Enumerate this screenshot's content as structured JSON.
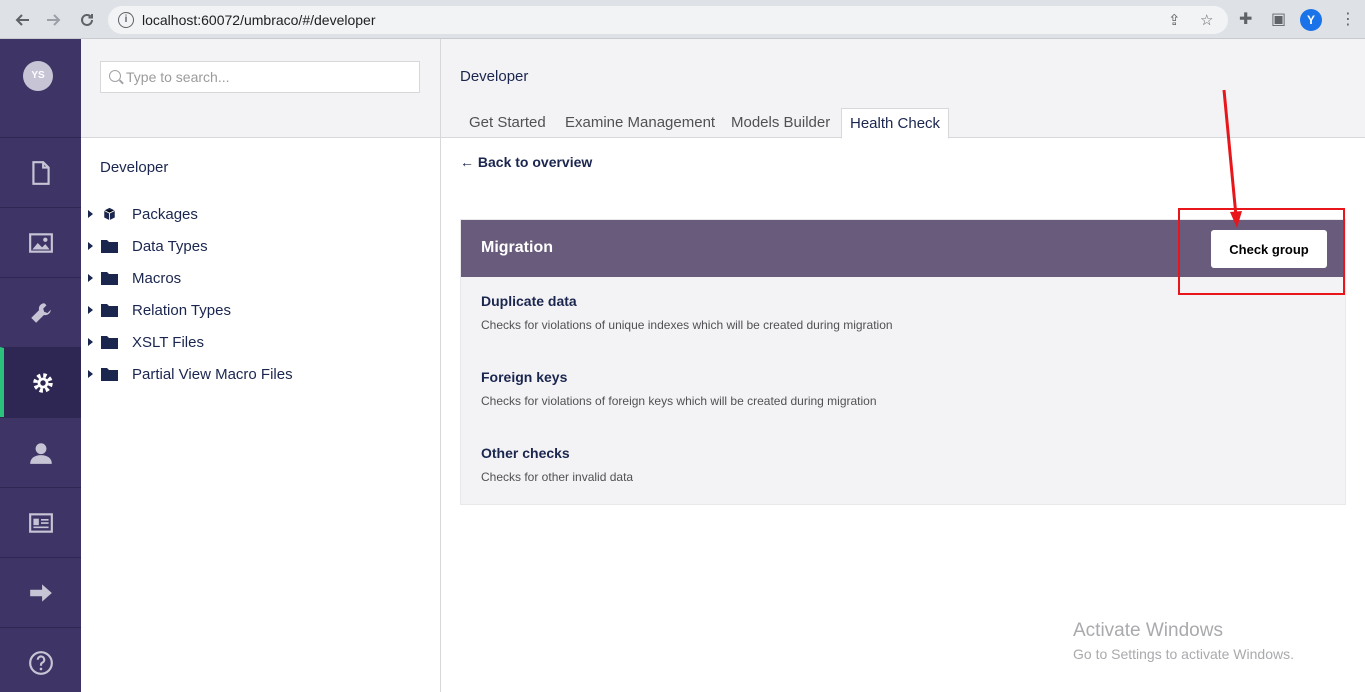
{
  "browser": {
    "url": "localhost:60072/umbraco/#/developer",
    "profile_initial": "Y",
    "icons": [
      "back-arrow-icon",
      "forward-arrow-icon",
      "reload-icon",
      "info-icon",
      "share-icon",
      "star-icon",
      "extensions-icon",
      "side-panel-icon",
      "kebab-menu-icon"
    ]
  },
  "sections": {
    "avatar": "YS",
    "items": [
      {
        "name": "content",
        "icon": "document-icon"
      },
      {
        "name": "media",
        "icon": "image-icon"
      },
      {
        "name": "settings",
        "icon": "wrench-icon"
      },
      {
        "name": "developer",
        "icon": "gear-icon",
        "active": true
      },
      {
        "name": "users",
        "icon": "user-icon"
      },
      {
        "name": "members",
        "icon": "id-card-icon"
      },
      {
        "name": "forms",
        "icon": "arrow-right-icon"
      },
      {
        "name": "help",
        "icon": "help-icon"
      }
    ],
    "accent_color": "#2bc37c",
    "background_color": "#3e3465"
  },
  "tree": {
    "search_placeholder": "Type to search...",
    "title": "Developer",
    "items": [
      {
        "label": "Packages",
        "icon": "package-icon"
      },
      {
        "label": "Data Types",
        "icon": "folder-icon"
      },
      {
        "label": "Macros",
        "icon": "folder-icon"
      },
      {
        "label": "Relation Types",
        "icon": "folder-icon"
      },
      {
        "label": "XSLT Files",
        "icon": "folder-icon"
      },
      {
        "label": "Partial View Macro Files",
        "icon": "folder-icon"
      }
    ]
  },
  "main": {
    "title": "Developer",
    "tabs": [
      {
        "label": "Get Started"
      },
      {
        "label": "Examine Management"
      },
      {
        "label": "Models Builder"
      },
      {
        "label": "Health Check",
        "active": true
      }
    ],
    "back_link": "← Back to overview",
    "group": {
      "title": "Migration",
      "button_label": "Check group",
      "header_color": "#685b7b",
      "checks": [
        {
          "name": "Duplicate data",
          "description": "Checks for violations of unique indexes which will be created during migration"
        },
        {
          "name": "Foreign keys",
          "description": "Checks for violations of foreign keys which will be created during migration"
        },
        {
          "name": "Other checks",
          "description": "Checks for other invalid data"
        }
      ]
    }
  },
  "annotation_color": "#e8161b",
  "watermark": {
    "line1": "Activate Windows",
    "line2": "Go to Settings to activate Windows."
  }
}
